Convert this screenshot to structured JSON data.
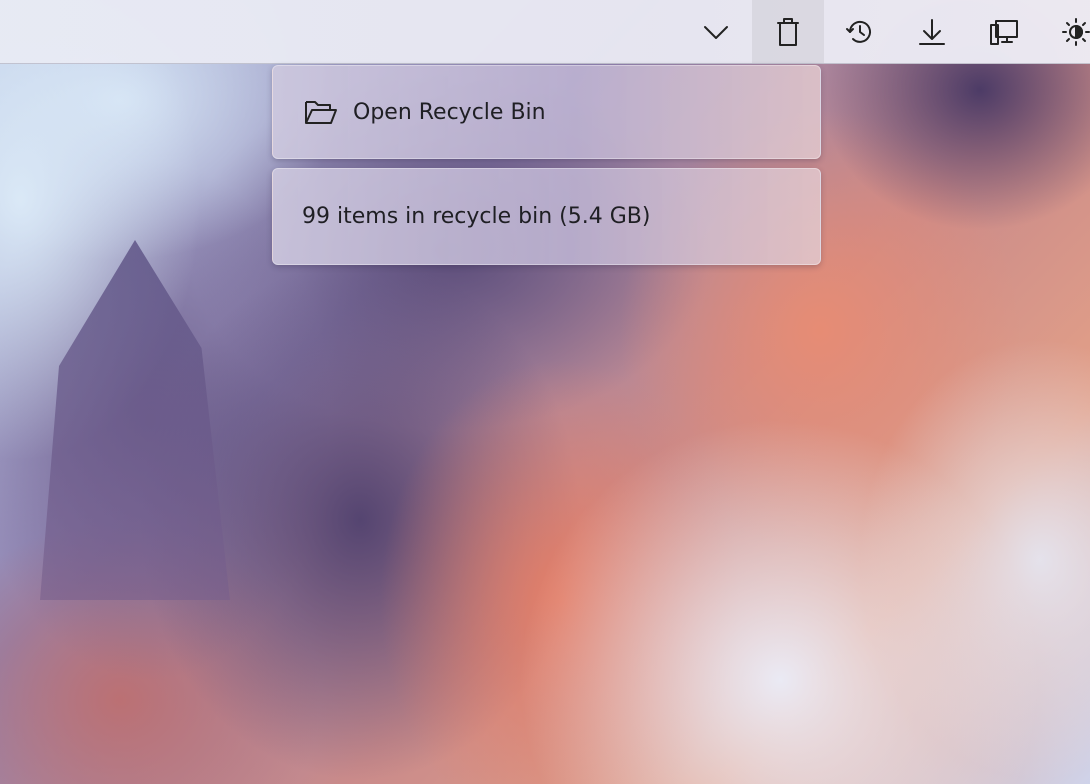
{
  "toolbar": {
    "buttons": [
      {
        "icon": "chevron-down-icon"
      },
      {
        "icon": "trash-icon",
        "active": true
      },
      {
        "icon": "history-icon"
      },
      {
        "icon": "download-icon"
      },
      {
        "icon": "monitor-icon"
      },
      {
        "icon": "brightness-icon"
      }
    ]
  },
  "recycle_menu": {
    "open_label": "Open Recycle Bin",
    "open_icon": "folder-open-icon",
    "status_text": "99 items in recycle bin (5.4 GB)"
  }
}
